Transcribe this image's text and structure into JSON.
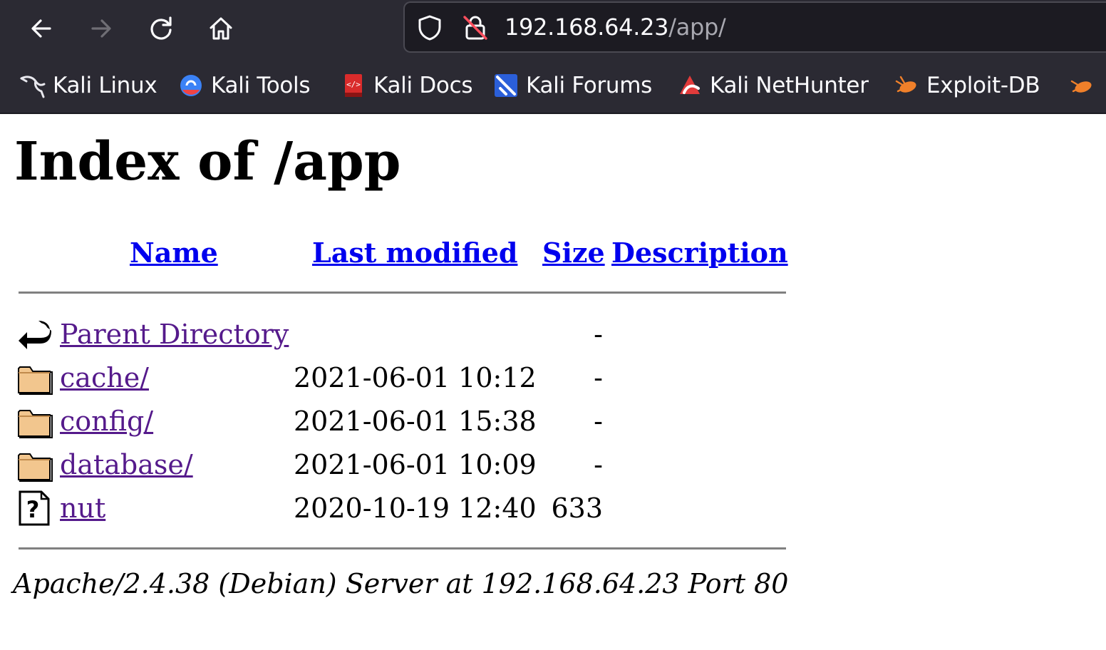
{
  "browser": {
    "url_host": "192.168.64.23",
    "url_path": "/app/",
    "bookmarks": [
      {
        "label": "Kali Linux",
        "icon": "kali-dragon-icon"
      },
      {
        "label": "Kali Tools",
        "icon": "kali-tools-icon"
      },
      {
        "label": "Kali Docs",
        "icon": "kali-docs-icon"
      },
      {
        "label": "Kali Forums",
        "icon": "kali-forums-icon"
      },
      {
        "label": "Kali NetHunter",
        "icon": "nethunter-icon"
      },
      {
        "label": "Exploit-DB",
        "icon": "exploit-db-icon"
      }
    ],
    "colors": {
      "toolbar": "#2b2a33",
      "urlbar": "#1c1b22"
    }
  },
  "page": {
    "title": "Index of /app",
    "columns": {
      "name": "Name",
      "last_modified": "Last modified",
      "size": "Size",
      "description": "Description"
    },
    "rows": [
      {
        "name": "Parent Directory",
        "date": "",
        "size": "-",
        "icon": "back-arrow-icon"
      },
      {
        "name": "cache/",
        "date": "2021-06-01 10:12",
        "size": "-",
        "icon": "folder-icon"
      },
      {
        "name": "config/",
        "date": "2021-06-01 15:38",
        "size": "-",
        "icon": "folder-icon"
      },
      {
        "name": "database/",
        "date": "2021-06-01 10:09",
        "size": "-",
        "icon": "folder-icon"
      },
      {
        "name": "nut",
        "date": "2020-10-19 12:40",
        "size": "633",
        "icon": "unknown-file-icon"
      }
    ],
    "address": "Apache/2.4.38 (Debian) Server at 192.168.64.23 Port 80",
    "colors": {
      "link": "#0000ee",
      "visited": "#551a8b",
      "rule": "#808080"
    }
  }
}
